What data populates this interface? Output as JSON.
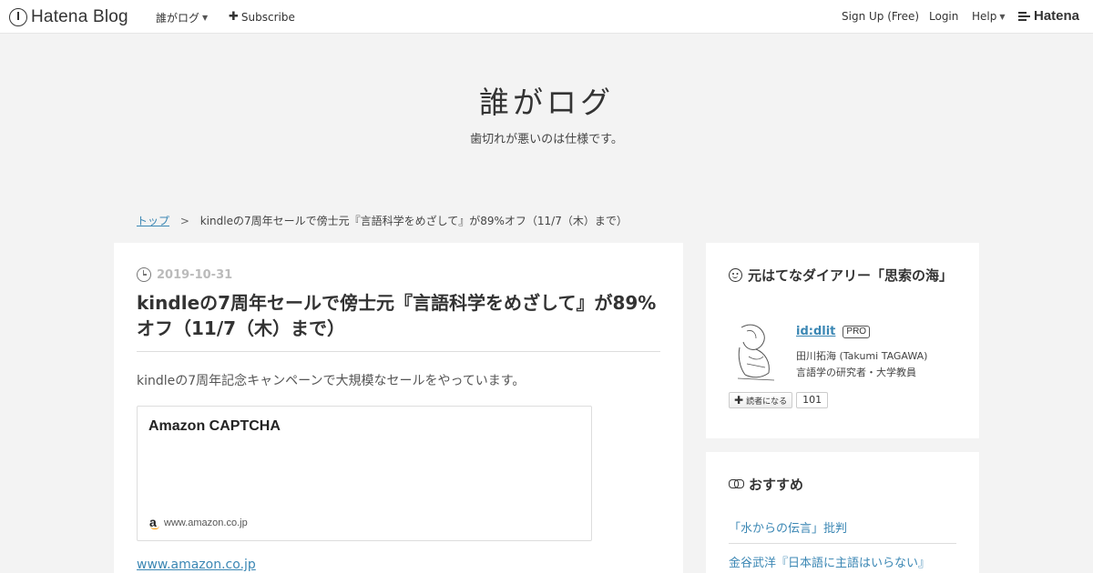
{
  "topbar": {
    "logo_text": "Hatena Blog",
    "blog_menu_label": "誰がログ",
    "subscribe_label": "Subscribe",
    "signup_label": "Sign Up (Free)",
    "login_label": "Login",
    "help_label": "Help",
    "hatena_label": "Hatena"
  },
  "header": {
    "title": "誰がログ",
    "description": "歯切れが悪いのは仕様です。"
  },
  "breadcrumb": {
    "home": "トップ",
    "separator": ">",
    "current": "kindleの7周年セールで傍士元『言語科学をめざして』が89%オフ（11/7（木）まで）"
  },
  "entry": {
    "date": "2019-10-31",
    "title": "kindleの7周年セールで傍士元『言語科学をめざして』が89%オフ（11/7（木）まで）",
    "lead": "kindleの7周年記念キャンペーンで大規模なセールをやっています。",
    "embed_title": "Amazon CAPTCHA",
    "embed_domain": "www.amazon.co.jp",
    "link_text": "www.amazon.co.jp"
  },
  "profile": {
    "heading": "元はてなダイアリー「思索の海」",
    "user_id": "id:dlit",
    "badge": "PRO",
    "name": "田川拓海 (Takumi TAGAWA)",
    "bio": "言語学の研究者・大学教員",
    "subscribe_label": "読者になる",
    "subscriber_count": "101"
  },
  "recommend": {
    "heading": "おすすめ",
    "items": [
      "「水からの伝言」批判",
      "金谷武洋『日本語に主語はいらない』"
    ]
  },
  "colors": {
    "link": "#3b87b4",
    "background": "#f3f3f3",
    "panel": "#ffffff"
  }
}
